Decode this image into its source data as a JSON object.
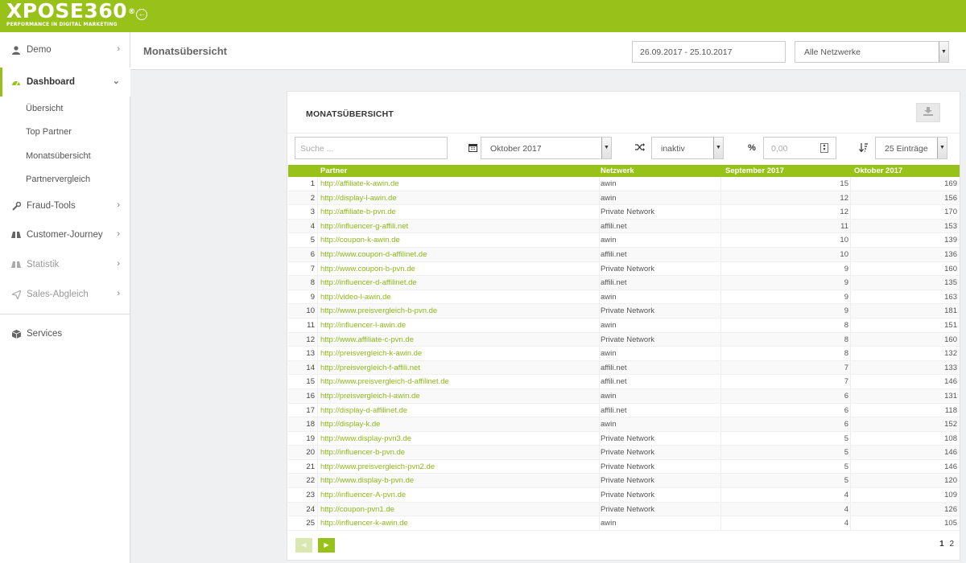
{
  "brand": {
    "name": "XPOSE360",
    "reg": "®",
    "tagline": "PERFORMANCE IN DIGITAL MARKETING",
    "accent": "#98c21a"
  },
  "sidebar": {
    "items": [
      {
        "label": "Demo",
        "icon": "user-icon"
      },
      {
        "label": "Dashboard",
        "icon": "dashboard-icon",
        "active": true
      },
      {
        "label": "Fraud-Tools",
        "icon": "wrench-icon"
      },
      {
        "label": "Customer-Journey",
        "icon": "binoculars-icon"
      },
      {
        "label": "Statistik",
        "icon": "binoculars-icon",
        "disabled": true
      },
      {
        "label": "Sales-Abgleich",
        "icon": "send-icon",
        "disabled": true
      },
      {
        "label": "Services",
        "icon": "cube-icon"
      }
    ],
    "dashboard_sub": [
      "Übersicht",
      "Top Partner",
      "Monatsübersicht",
      "Partnervergleich"
    ]
  },
  "header": {
    "title": "Monatsübersicht",
    "date_range": "26.09.2017 - 25.10.2017",
    "network_select": "Alle Netzwerke"
  },
  "card": {
    "title": "MONATSÜBERSICHT",
    "search_placeholder": "Suche ...",
    "month_select": "Oktober 2017",
    "mode_select": "inaktiv",
    "percent_placeholder": "0,00",
    "entries_select": "25 Einträge"
  },
  "table": {
    "columns": [
      "Partner",
      "Netzwerk",
      "September 2017",
      "Oktober 2017"
    ],
    "rows": [
      {
        "idx": "1",
        "partner": "http://affiliate-k-awin.de",
        "network": "awin",
        "sep": "15",
        "okt": "169"
      },
      {
        "idx": "2",
        "partner": "http://display-l-awin.de",
        "network": "awin",
        "sep": "12",
        "okt": "156"
      },
      {
        "idx": "3",
        "partner": "http://affiliate-b-pvn.de",
        "network": "Private Network",
        "sep": "12",
        "okt": "170"
      },
      {
        "idx": "4",
        "partner": "http://influencer-g-affili.net",
        "network": "affili.net",
        "sep": "11",
        "okt": "153"
      },
      {
        "idx": "5",
        "partner": "http://coupon-k-awin.de",
        "network": "awin",
        "sep": "10",
        "okt": "139"
      },
      {
        "idx": "6",
        "partner": "http://www.coupon-d-affilinet.de",
        "network": "affili.net",
        "sep": "10",
        "okt": "136"
      },
      {
        "idx": "7",
        "partner": "http://www.coupon-b-pvn.de",
        "network": "Private Network",
        "sep": "9",
        "okt": "160"
      },
      {
        "idx": "8",
        "partner": "http://influencer-d-affilinet.de",
        "network": "affili.net",
        "sep": "9",
        "okt": "135"
      },
      {
        "idx": "9",
        "partner": "http://video-l-awin.de",
        "network": "awin",
        "sep": "9",
        "okt": "163"
      },
      {
        "idx": "10",
        "partner": "http://www.preisvergleich-b-pvn.de",
        "network": "Private Network",
        "sep": "9",
        "okt": "181"
      },
      {
        "idx": "11",
        "partner": "http://influencer-l-awin.de",
        "network": "awin",
        "sep": "8",
        "okt": "151"
      },
      {
        "idx": "12",
        "partner": "http://www.affiliate-c-pvn.de",
        "network": "Private Network",
        "sep": "8",
        "okt": "160"
      },
      {
        "idx": "13",
        "partner": "http://preisvergleich-k-awin.de",
        "network": "awin",
        "sep": "8",
        "okt": "132"
      },
      {
        "idx": "14",
        "partner": "http://preisvergleich-f-affili.net",
        "network": "affili.net",
        "sep": "7",
        "okt": "133"
      },
      {
        "idx": "15",
        "partner": "http://www.preisvergleich-d-affilinet.de",
        "network": "affili.net",
        "sep": "7",
        "okt": "146"
      },
      {
        "idx": "16",
        "partner": "http://preisvergleich-l-awin.de",
        "network": "awin",
        "sep": "6",
        "okt": "131"
      },
      {
        "idx": "17",
        "partner": "http://display-d-affilinet.de",
        "network": "affili.net",
        "sep": "6",
        "okt": "118"
      },
      {
        "idx": "18",
        "partner": "http://display-k.de",
        "network": "awin",
        "sep": "6",
        "okt": "152"
      },
      {
        "idx": "19",
        "partner": "http://www.display-pvn3.de",
        "network": "Private Network",
        "sep": "5",
        "okt": "108"
      },
      {
        "idx": "20",
        "partner": "http://influencer-b-pvn.de",
        "network": "Private Network",
        "sep": "5",
        "okt": "146"
      },
      {
        "idx": "21",
        "partner": "http://www.preisvergleich-pvn2.de",
        "network": "Private Network",
        "sep": "5",
        "okt": "146"
      },
      {
        "idx": "22",
        "partner": "http://www.display-b-pvn.de",
        "network": "Private Network",
        "sep": "5",
        "okt": "120"
      },
      {
        "idx": "23",
        "partner": "http://influencer-A-pvn.de",
        "network": "Private Network",
        "sep": "4",
        "okt": "109"
      },
      {
        "idx": "24",
        "partner": "http://coupon-pvn1.de",
        "network": "Private Network",
        "sep": "4",
        "okt": "126"
      },
      {
        "idx": "25",
        "partner": "http://influencer-k-awin.de",
        "network": "awin",
        "sep": "4",
        "okt": "105"
      }
    ]
  },
  "pagination": {
    "pages": [
      "1",
      "2"
    ],
    "current": "1"
  }
}
